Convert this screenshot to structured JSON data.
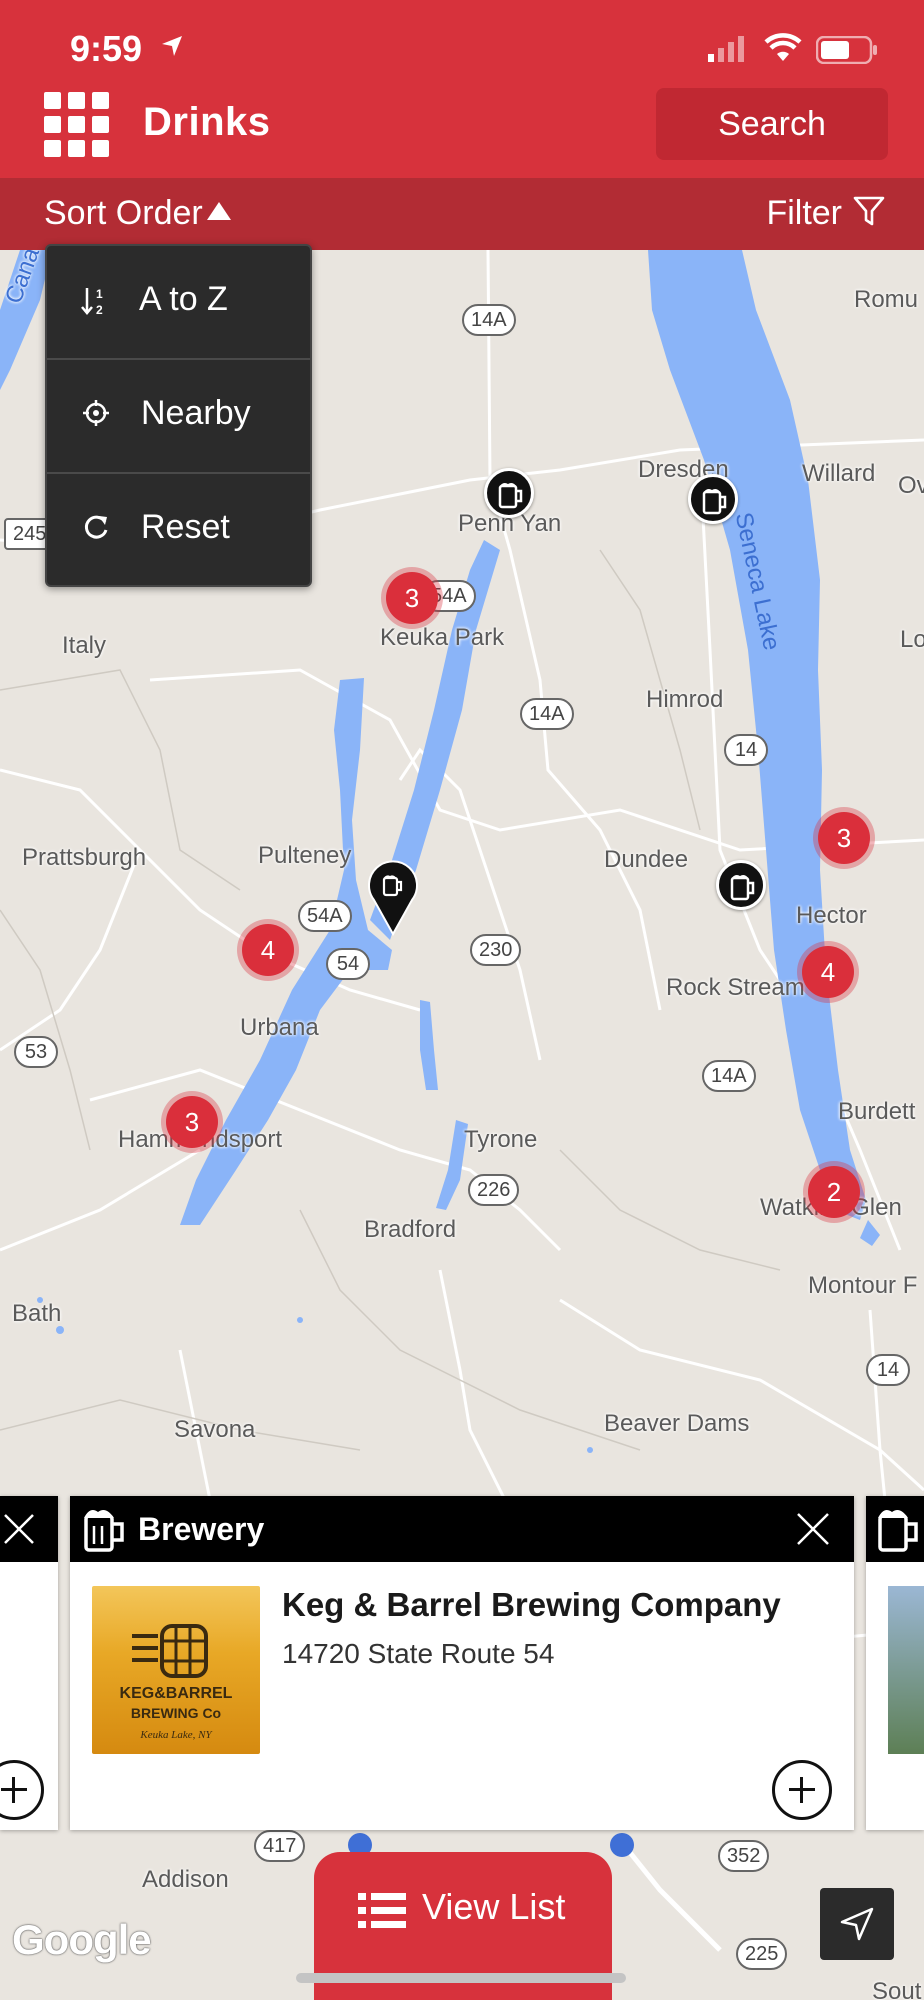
{
  "status": {
    "time": "9:59"
  },
  "header": {
    "title": "Drinks",
    "search_label": "Search",
    "sort_label": "Sort Order",
    "filter_label": "Filter"
  },
  "sort_menu": [
    {
      "label": "A to Z",
      "icon": "sort-alpha-icon"
    },
    {
      "label": "Nearby",
      "icon": "crosshair-icon"
    },
    {
      "label": "Reset",
      "icon": "refresh-icon"
    }
  ],
  "map": {
    "places": [
      "Canand",
      "Romu",
      "Penn Yan",
      "Dresden",
      "Willard",
      "Ov",
      "Keuka Park",
      "Italy",
      "Lo",
      "Himrod",
      "Prattsburgh",
      "Pulteney",
      "Dundee",
      "Hector",
      "Rock Stream",
      "Urbana",
      "Burdett",
      "Hammondsport",
      "Tyrone",
      "Bradford",
      "Watkins Glen",
      "Montour F",
      "Bath",
      "Savona",
      "Beaver Dams",
      "Addison",
      "Sout"
    ],
    "lake_label": "Seneca Lake",
    "shields": [
      "14A",
      "54A",
      "14A",
      "14",
      "54A",
      "54",
      "230",
      "53",
      "14A",
      "226",
      "14",
      "245",
      "417",
      "352",
      "225"
    ],
    "clusters": [
      "3",
      "3",
      "4",
      "4",
      "3",
      "2"
    ]
  },
  "card": {
    "type": "Brewery",
    "name": "Keg & Barrel Brewing Company",
    "address": "14720 State Route 54",
    "image_text": [
      "KEG&BARREL",
      "BREWING Co",
      "Keuka Lake, NY"
    ]
  },
  "bottom": {
    "view_list_label": "View List",
    "google_label": "Google"
  },
  "colors": {
    "brand_red": "#d7323c",
    "lake_blue": "#8ab4f8",
    "land": "#e9e5df"
  }
}
